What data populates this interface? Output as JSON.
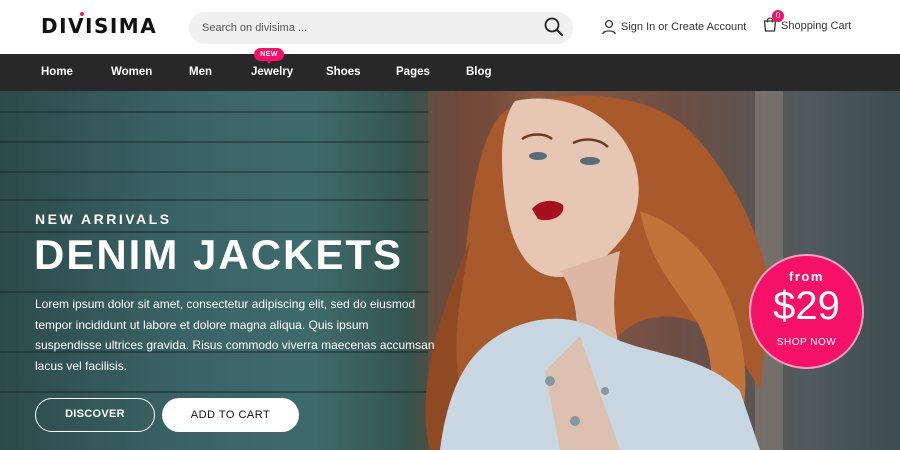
{
  "header": {
    "logo": "DIVISIMA",
    "search_placeholder": "Search on divisima ...",
    "account_label": "Sign In or Create Account",
    "cart_label": "Shopping Cart",
    "cart_count": "0"
  },
  "nav": {
    "items": [
      {
        "label": "Home"
      },
      {
        "label": "Women"
      },
      {
        "label": "Men"
      },
      {
        "label": "Jewelry"
      },
      {
        "label": "Shoes"
      },
      {
        "label": "Pages"
      },
      {
        "label": "Blog"
      }
    ],
    "new_badge": "NEW"
  },
  "hero": {
    "kicker": "NEW ARRIVALS",
    "title": "DENIM JACKETS",
    "text": "Lorem ipsum dolor sit amet, consectetur adipiscing elit, sed do eiusmod tempor incididunt ut labore et dolore magna aliqua. Quis ipsum suspendisse ultrices gravida. Risus commodo viverra maecenas accumsan lacus vel facilisis.",
    "discover_label": "DISCOVER",
    "add_to_cart_label": "ADD TO CART",
    "price": {
      "from": "from",
      "amount": "$29",
      "cta": "SHOP NOW"
    }
  },
  "colors": {
    "accent": "#f51167",
    "nav_bg": "#282828",
    "search_bg": "#f0f0f0"
  },
  "icons": [
    "search-icon",
    "user-icon",
    "shopping-bag-icon"
  ]
}
